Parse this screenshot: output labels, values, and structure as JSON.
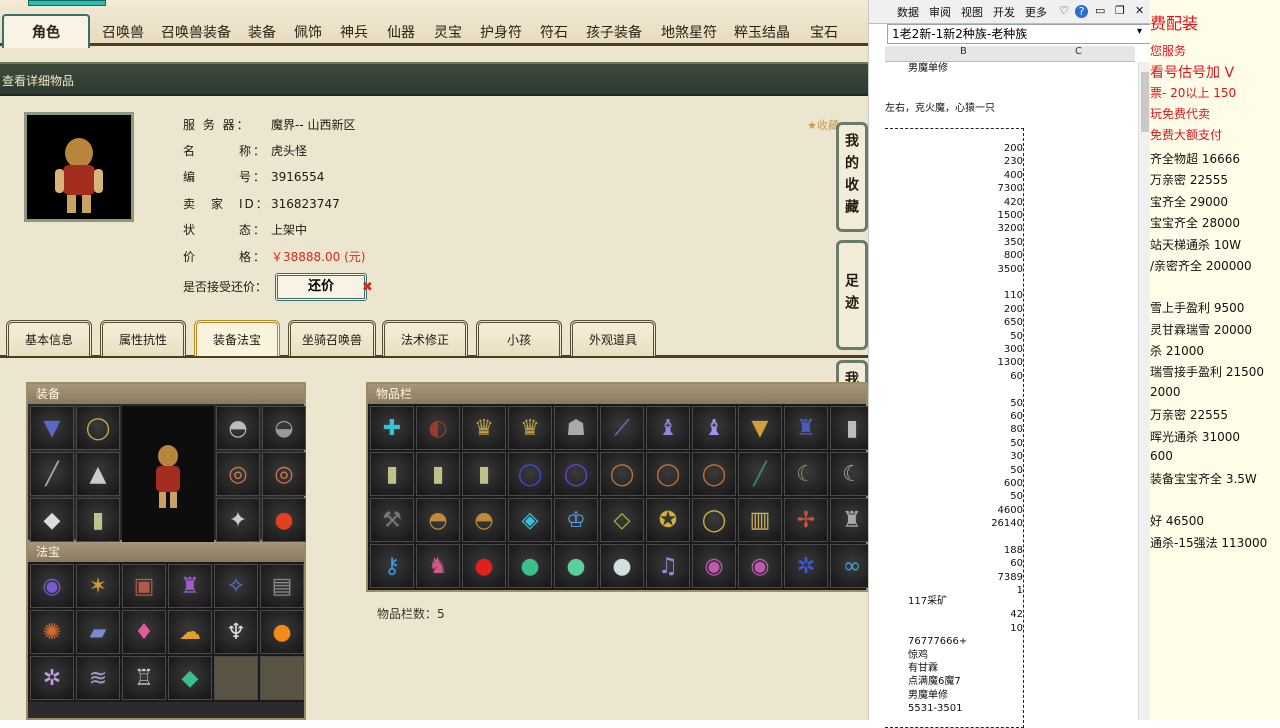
{
  "nav": {
    "tabs": [
      "角色",
      "召唤兽",
      "召唤兽装备",
      "装备",
      "佩饰",
      "神兵",
      "仙器",
      "灵宝",
      "护身符",
      "符石",
      "孩子装备",
      "地煞星符",
      "粹玉结晶",
      "宝石"
    ],
    "active": 0
  },
  "title_bar": "查看详细物品",
  "favorite_link": "收藏",
  "info": {
    "server_label": "服 务 器：",
    "server": "魔界-- 山西新区",
    "name_label": "名　　　称：",
    "name": "虎头怪",
    "id_label": "编　　　号：",
    "id": "3916554",
    "seller_label": "卖　家　ID：",
    "seller": "316823747",
    "status_label": "状　　　态：",
    "status": "上架中",
    "price_label": "价　　　格：",
    "price": "￥38888.00 (元)",
    "counter_label": "是否接受还价：",
    "counter_button": "还价",
    "counter_flag": "✖"
  },
  "side_buttons": [
    "我的收藏",
    "足迹",
    "我的还价"
  ],
  "subtabs": [
    "基本信息",
    "属性抗性",
    "装备法宝",
    "坐骑召唤兽",
    "法术修正",
    "小孩",
    "外观道具"
  ],
  "subtab_active": 2,
  "panels": {
    "equip_title": "装备",
    "treasure_title": "法宝",
    "inventory_title": "物品栏",
    "inventory_count": "物品栏数：5"
  },
  "excel": {
    "ribbon": [
      "数据",
      "审阅",
      "视图",
      "开发",
      "更多"
    ],
    "formula": "1老2新-1新2种族-老种族",
    "col_b": "B",
    "col_c": "C",
    "rows_top": [
      "男魔单修",
      "左右，克火魔，心猿一只"
    ],
    "numbers": [
      "200",
      "230",
      "400",
      "7300",
      "420",
      "1500",
      "3200",
      "350",
      "800",
      "3500",
      "",
      "110",
      "200",
      "650",
      "50",
      "300",
      "1300",
      "60",
      "",
      "50",
      "60",
      "80",
      "50",
      "30",
      "50",
      "600",
      "50",
      "4600",
      "26140",
      "",
      "188",
      "60",
      "7389",
      "1"
    ],
    "rows_bottom": [
      "117采矿",
      "",
      "",
      "76777666+",
      "惊鸡",
      "有甘霖",
      "点满魔6魔7",
      "男魔单修",
      "5531-3501"
    ],
    "bottom_numbers": [
      "42",
      "10"
    ]
  },
  "notes": [
    {
      "t": "费配装",
      "red": true
    },
    {
      "t": "您服务",
      "red": true
    },
    {
      "t": "看号估号加 V",
      "red": true
    },
    {
      "t": "票- 20以上 150",
      "red": true
    },
    {
      "t": "玩免费代卖",
      "red": true
    },
    {
      "t": "免费大额支付",
      "red": true
    },
    {
      "t": "齐全物超 16666",
      "red": false
    },
    {
      "t": "万亲密 22555",
      "red": false
    },
    {
      "t": "宝齐全 29000",
      "red": false
    },
    {
      "t": "宝宝齐全 28000",
      "red": false
    },
    {
      "t": "站天梯通杀 10W",
      "red": false
    },
    {
      "t": "/亲密齐全 200000",
      "red": false
    },
    {
      "t": "雪上手盈利 9500",
      "red": false
    },
    {
      "t": "灵甘霖瑞雪 20000",
      "red": false
    },
    {
      "t": "杀 21000",
      "red": false
    },
    {
      "t": "瑞雪接手盈利 21500",
      "red": false
    },
    {
      "t": "2000",
      "red": false
    },
    {
      "t": "万亲密 22555",
      "red": false
    },
    {
      "t": "晖光通杀 31000",
      "red": false
    },
    {
      "t": "600",
      "red": false
    },
    {
      "t": "装备宝宝齐全 3.5W",
      "red": false
    },
    {
      "t": "好 46500",
      "red": false
    },
    {
      "t": "通杀-15强法 113000",
      "red": false
    }
  ]
}
